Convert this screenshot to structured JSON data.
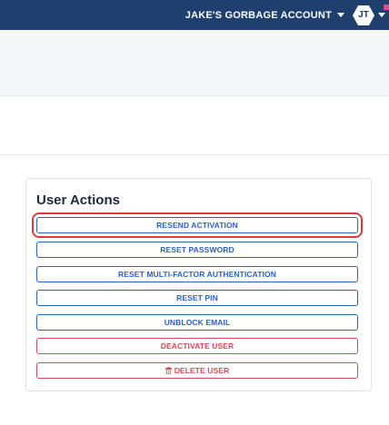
{
  "header": {
    "account_name": "JAKE'S GORBAGE ACCOUNT",
    "avatar_initials": "JT",
    "brand_color": "#1f3f6f",
    "notification_color": "#e04a8f"
  },
  "user_actions": {
    "title": "User Actions",
    "buttons": [
      {
        "label": "RESEND ACTIVATION",
        "style": "primary",
        "highlighted": true
      },
      {
        "label": "RESET PASSWORD",
        "style": "primary"
      },
      {
        "label": "RESET MULTI-FACTOR AUTHENTICATION",
        "style": "primary"
      },
      {
        "label": "RESET PIN",
        "style": "primary"
      },
      {
        "label": "UNBLOCK EMAIL",
        "style": "primary"
      },
      {
        "label": "DEACTIVATE USER",
        "style": "danger"
      },
      {
        "label": "DELETE USER",
        "style": "danger",
        "icon": "trash-icon"
      }
    ],
    "primary_color": "#2b5fc2",
    "danger_color": "#d64b55",
    "highlight_color": "#e0393e"
  }
}
